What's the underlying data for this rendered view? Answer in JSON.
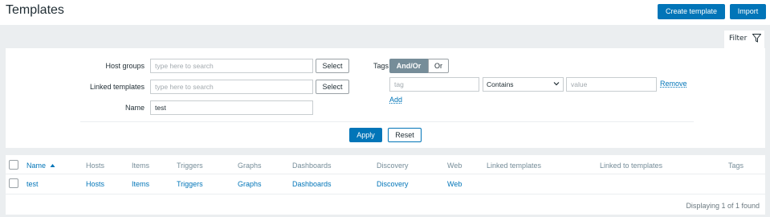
{
  "header": {
    "title": "Templates",
    "create_label": "Create template",
    "import_label": "Import"
  },
  "filter": {
    "tab_label": "Filter",
    "host_groups": {
      "label": "Host groups",
      "placeholder": "type here to search",
      "select_label": "Select"
    },
    "linked_templates": {
      "label": "Linked templates",
      "placeholder": "type here to search",
      "select_label": "Select"
    },
    "name": {
      "label": "Name",
      "value": "test"
    },
    "tags": {
      "label": "Tags",
      "operator_options": [
        "And/Or",
        "Or"
      ],
      "operator_selected": "And/Or",
      "rows": [
        {
          "tag_placeholder": "tag",
          "operator": "Contains",
          "value_placeholder": "value",
          "remove_label": "Remove"
        }
      ],
      "add_label": "Add"
    },
    "apply_label": "Apply",
    "reset_label": "Reset"
  },
  "table": {
    "columns": [
      "Name",
      "Hosts",
      "Items",
      "Triggers",
      "Graphs",
      "Dashboards",
      "Discovery",
      "Web",
      "Linked templates",
      "Linked to templates",
      "Tags"
    ],
    "sort_column": "Name",
    "sort_direction": "asc",
    "rows": [
      {
        "name": "test",
        "hosts": "Hosts",
        "items": "Items",
        "triggers": "Triggers",
        "graphs": "Graphs",
        "dashboards": "Dashboards",
        "discovery": "Discovery",
        "web": "Web"
      }
    ],
    "footer": "Displaying 1 of 1 found"
  },
  "colors": {
    "accent": "#0275b8",
    "page_bg": "#ebeef0",
    "segment_active": "#768d99"
  }
}
